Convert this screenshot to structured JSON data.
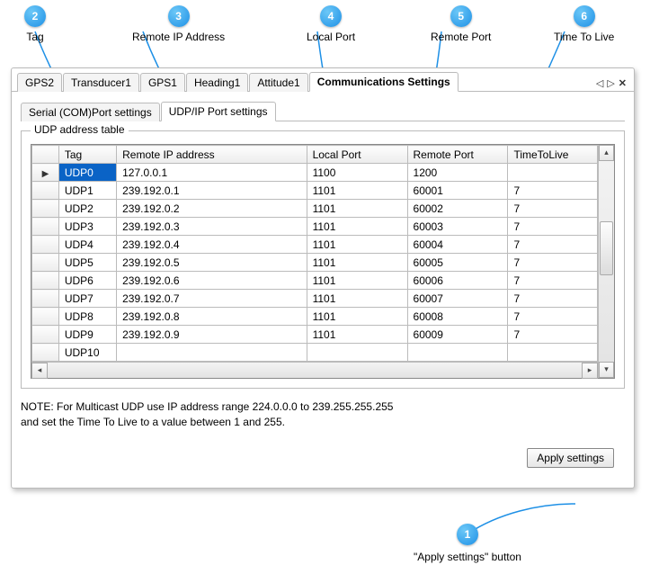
{
  "annotations": {
    "a1": {
      "num": "1",
      "label": "\"Apply settings\" button"
    },
    "a2": {
      "num": "2",
      "label": "Tag"
    },
    "a3": {
      "num": "3",
      "label": "Remote IP Address"
    },
    "a4": {
      "num": "4",
      "label": "Local Port"
    },
    "a5": {
      "num": "5",
      "label": "Remote Port"
    },
    "a6": {
      "num": "6",
      "label": "Time To Live"
    }
  },
  "top_tabs": {
    "t0": "GPS2",
    "t1": "Transducer1",
    "t2": "GPS1",
    "t3": "Heading1",
    "t4": "Attitude1",
    "t5": "Communications Settings"
  },
  "sub_tabs": {
    "s0": "Serial (COM)Port settings",
    "s1": "UDP/IP Port settings"
  },
  "group_title": "UDP address table",
  "columns": {
    "tag": "Tag",
    "remote": "Remote IP address",
    "lport": "Local Port",
    "rport": "Remote Port",
    "ttl": "TimeToLive"
  },
  "rows": [
    {
      "tag": "UDP0",
      "remote": "127.0.0.1",
      "lport": "1100",
      "rport": "1200",
      "ttl": ""
    },
    {
      "tag": "UDP1",
      "remote": "239.192.0.1",
      "lport": "1101",
      "rport": "60001",
      "ttl": "7"
    },
    {
      "tag": "UDP2",
      "remote": "239.192.0.2",
      "lport": "1101",
      "rport": "60002",
      "ttl": "7"
    },
    {
      "tag": "UDP3",
      "remote": "239.192.0.3",
      "lport": "1101",
      "rport": "60003",
      "ttl": "7"
    },
    {
      "tag": "UDP4",
      "remote": "239.192.0.4",
      "lport": "1101",
      "rport": "60004",
      "ttl": "7"
    },
    {
      "tag": "UDP5",
      "remote": "239.192.0.5",
      "lport": "1101",
      "rport": "60005",
      "ttl": "7"
    },
    {
      "tag": "UDP6",
      "remote": "239.192.0.6",
      "lport": "1101",
      "rport": "60006",
      "ttl": "7"
    },
    {
      "tag": "UDP7",
      "remote": "239.192.0.7",
      "lport": "1101",
      "rport": "60007",
      "ttl": "7"
    },
    {
      "tag": "UDP8",
      "remote": "239.192.0.8",
      "lport": "1101",
      "rport": "60008",
      "ttl": "7"
    },
    {
      "tag": "UDP9",
      "remote": "239.192.0.9",
      "lport": "1101",
      "rport": "60009",
      "ttl": "7"
    },
    {
      "tag": "UDP10",
      "remote": "",
      "lport": "",
      "rport": "",
      "ttl": ""
    }
  ],
  "note_line1": "NOTE: For Multicast UDP use IP address range 224.0.0.0 to 239.255.255.255",
  "note_line2": " and set the Time To Live to a value between 1 and 255.",
  "apply_label": "Apply settings"
}
